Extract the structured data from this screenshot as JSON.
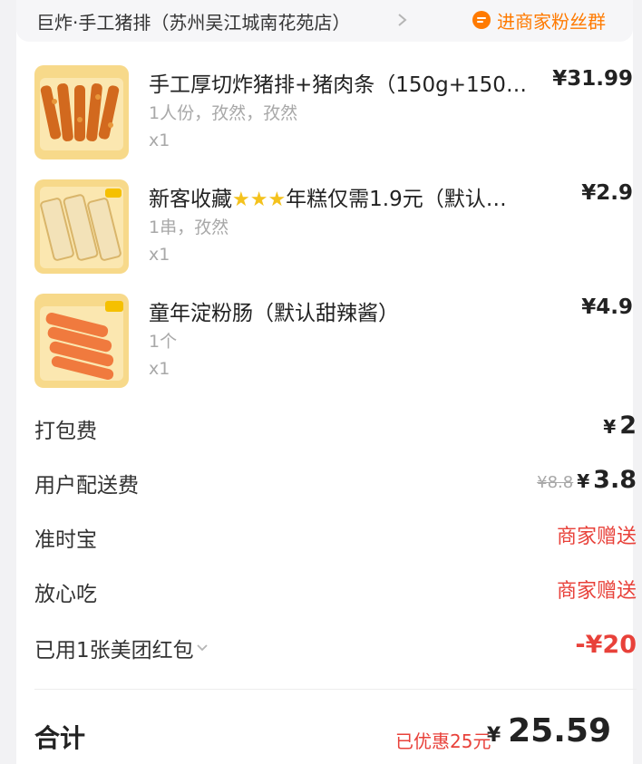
{
  "header": {
    "shop_name": "巨炸·手工猪排（苏州吴江城南花苑店）",
    "fan_group_label": "进商家粉丝群"
  },
  "items": [
    {
      "name": "手工厚切炸猪排+猪肉条（150g+150…",
      "price": "¥31.99",
      "spec": "1人份，孜然，孜然",
      "qty": "x1"
    },
    {
      "name_prefix": "新客收藏",
      "stars": "★★★",
      "name_suffix": "年糕仅需1.9元（默认…",
      "price": "¥2.9",
      "spec": "1串，孜然",
      "qty": "x1"
    },
    {
      "name": "童年淀粉肠（默认甜辣酱）",
      "price": "¥4.9",
      "spec": "1个",
      "qty": "x1"
    }
  ],
  "fees": {
    "packing": {
      "label": "打包费",
      "yen": "¥",
      "value": "2"
    },
    "delivery": {
      "label": "用户配送费",
      "original": "¥8.8",
      "yen": "¥",
      "value": "3.8"
    },
    "ontime": {
      "label": "准时宝",
      "value": "商家赠送"
    },
    "safe": {
      "label": "放心吃",
      "value": "商家赠送"
    },
    "redpacket": {
      "label": "已用1张美团红包",
      "value": "-¥20"
    }
  },
  "total": {
    "label": "合计",
    "discount": "已优惠25元",
    "yen": "¥",
    "value": "25.59"
  },
  "colors": {
    "accent_orange": "#ff7a00",
    "discount_red": "#e8413a",
    "star_yellow": "#f4c21d"
  }
}
